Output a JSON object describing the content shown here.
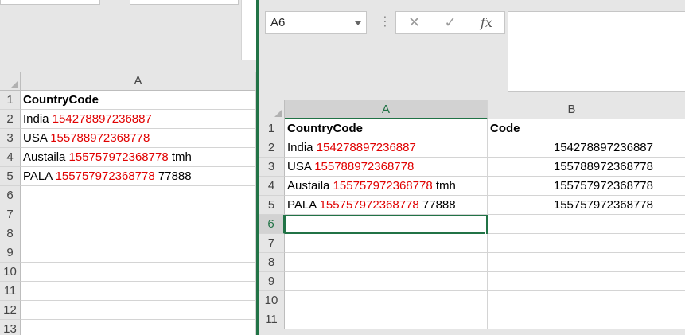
{
  "left_window": {
    "columns": [
      "A"
    ],
    "rows": [
      {
        "num": "1",
        "a": {
          "text": "CountryCode",
          "bold": true
        }
      },
      {
        "num": "2",
        "a": {
          "prefix": "India ",
          "red": "154278897236887",
          "suffix": ""
        }
      },
      {
        "num": "3",
        "a": {
          "prefix": "USA ",
          "red": "155788972368778",
          "suffix": ""
        }
      },
      {
        "num": "4",
        "a": {
          "prefix": "Austaila ",
          "red": "155757972368778",
          "suffix": " tmh"
        }
      },
      {
        "num": "5",
        "a": {
          "prefix": "PALA ",
          "red": "155757972368778",
          "suffix": " 77888"
        }
      },
      {
        "num": "6"
      },
      {
        "num": "7"
      },
      {
        "num": "8"
      },
      {
        "num": "9"
      },
      {
        "num": "10"
      },
      {
        "num": "11"
      },
      {
        "num": "12"
      },
      {
        "num": "13"
      }
    ]
  },
  "right_window": {
    "name_box": "A6",
    "formula_icons": {
      "cancel": "✕",
      "enter": "✓",
      "fx": "fx"
    },
    "columns": [
      "A",
      "B"
    ],
    "selected_column": "A",
    "selected_row": "6",
    "rows": [
      {
        "num": "1",
        "a": {
          "text": "CountryCode",
          "bold": true
        },
        "b": {
          "text": "Code",
          "bold": true
        }
      },
      {
        "num": "2",
        "a": {
          "prefix": "India ",
          "red": "154278897236887",
          "suffix": ""
        },
        "b": {
          "text": "154278897236887"
        }
      },
      {
        "num": "3",
        "a": {
          "prefix": "USA ",
          "red": "155788972368778",
          "suffix": ""
        },
        "b": {
          "text": "155788972368778"
        }
      },
      {
        "num": "4",
        "a": {
          "prefix": "Austaila ",
          "red": "155757972368778",
          "suffix": " tmh"
        },
        "b": {
          "text": "155757972368778"
        }
      },
      {
        "num": "5",
        "a": {
          "prefix": "PALA ",
          "red": "155757972368778",
          "suffix": " 77888"
        },
        "b": {
          "text": "155757972368778"
        }
      },
      {
        "num": "6"
      },
      {
        "num": "7"
      },
      {
        "num": "8"
      },
      {
        "num": "9"
      },
      {
        "num": "10"
      },
      {
        "num": "11"
      }
    ],
    "colors": {
      "accent": "#217346",
      "red_text": "#e00000"
    }
  }
}
